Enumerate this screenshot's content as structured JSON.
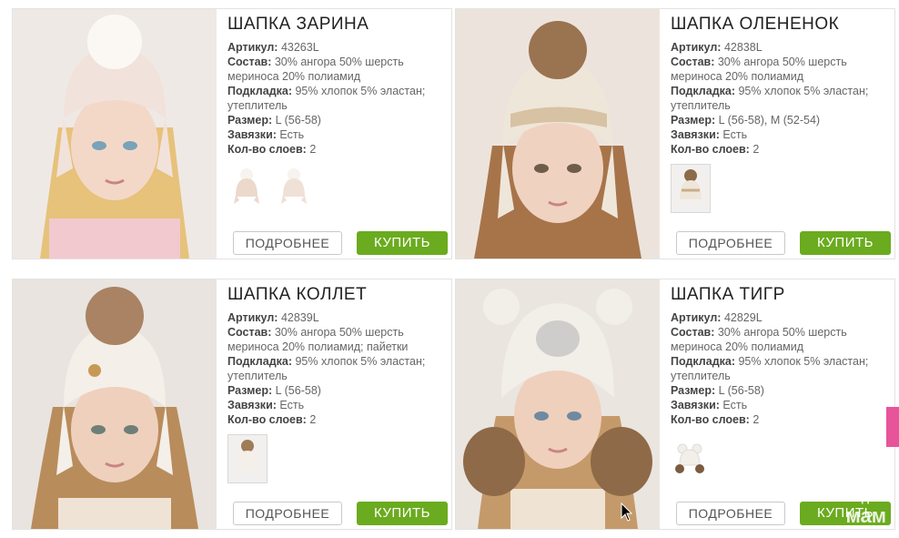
{
  "labels": {
    "article": "Артикул:",
    "composition": "Состав:",
    "lining": "Подкладка:",
    "size": "Размер:",
    "ties": "Завязки:",
    "layers": "Кол-во слоев:"
  },
  "buttons": {
    "more": "ПОДРОБНЕЕ",
    "buy": "КУПИТЬ"
  },
  "colors": {
    "buy_button": "#6bab1f",
    "side_tab": "#e8549a"
  },
  "products": [
    {
      "title": "ШАПКА ЗАРИНА",
      "article": "43263L",
      "composition": "30% ангора 50% шерсть мериноса 20% полиамид",
      "lining": "95% хлопок 5% эластан; утеплитель",
      "size": "L (56-58)",
      "ties": "Есть",
      "layers": "2"
    },
    {
      "title": "ШАПКА ОЛЕНЕНОК",
      "article": "42838L",
      "composition": "30% ангора 50% шерсть мериноса 20% полиамид",
      "lining": "95% хлопок 5% эластан; утеплитель",
      "size": "L (56-58), M (52-54)",
      "ties": "Есть",
      "layers": "2"
    },
    {
      "title": "ШАПКА КОЛЛЕТ",
      "article": "42839L",
      "composition": "30% ангора 50% шерсть мериноса 20% полиамид; пайетки",
      "lining": "95% хлопок 5% эластан; утеплитель",
      "size": "L (56-58)",
      "ties": "Есть",
      "layers": "2"
    },
    {
      "title": "ШАПКА ТИГР",
      "article": "42829L",
      "composition": "30% ангора 50% шерсть мериноса 20% полиамид",
      "lining": "95% хлопок 5% эластан; утеплитель",
      "size": "L (56-58)",
      "ties": "Есть",
      "layers": "2"
    }
  ],
  "watermark": {
    "top": "для",
    "bottom": "мам"
  }
}
